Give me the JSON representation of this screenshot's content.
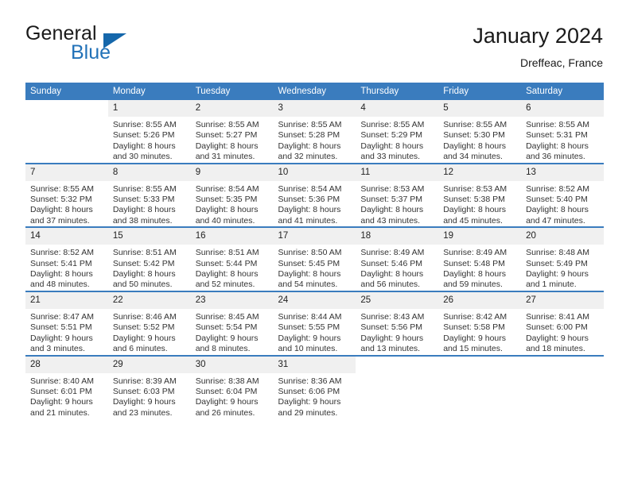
{
  "brand": {
    "word1": "General",
    "word2": "Blue",
    "triangle_color": "#1567ab",
    "blue_text_color": "#2272b8"
  },
  "header": {
    "title": "January 2024",
    "subtitle": "Dreffeac, France"
  },
  "theme": {
    "header_bg": "#3a7cbe",
    "daynum_bg": "#f0f0f0",
    "text": "#222222"
  },
  "calendar": {
    "weekdays": [
      "Sunday",
      "Monday",
      "Tuesday",
      "Wednesday",
      "Thursday",
      "Friday",
      "Saturday"
    ],
    "labels": {
      "sunrise": "Sunrise:",
      "sunset": "Sunset:",
      "daylight": "Daylight:"
    },
    "weeks": [
      [
        {
          "day": "",
          "sunrise": "",
          "sunset": "",
          "daylight_line1": "",
          "daylight_line2": "",
          "blank": true
        },
        {
          "day": "1",
          "sunrise": "Sunrise: 8:55 AM",
          "sunset": "Sunset: 5:26 PM",
          "daylight_line1": "Daylight: 8 hours",
          "daylight_line2": "and 30 minutes."
        },
        {
          "day": "2",
          "sunrise": "Sunrise: 8:55 AM",
          "sunset": "Sunset: 5:27 PM",
          "daylight_line1": "Daylight: 8 hours",
          "daylight_line2": "and 31 minutes."
        },
        {
          "day": "3",
          "sunrise": "Sunrise: 8:55 AM",
          "sunset": "Sunset: 5:28 PM",
          "daylight_line1": "Daylight: 8 hours",
          "daylight_line2": "and 32 minutes."
        },
        {
          "day": "4",
          "sunrise": "Sunrise: 8:55 AM",
          "sunset": "Sunset: 5:29 PM",
          "daylight_line1": "Daylight: 8 hours",
          "daylight_line2": "and 33 minutes."
        },
        {
          "day": "5",
          "sunrise": "Sunrise: 8:55 AM",
          "sunset": "Sunset: 5:30 PM",
          "daylight_line1": "Daylight: 8 hours",
          "daylight_line2": "and 34 minutes."
        },
        {
          "day": "6",
          "sunrise": "Sunrise: 8:55 AM",
          "sunset": "Sunset: 5:31 PM",
          "daylight_line1": "Daylight: 8 hours",
          "daylight_line2": "and 36 minutes."
        }
      ],
      [
        {
          "day": "7",
          "sunrise": "Sunrise: 8:55 AM",
          "sunset": "Sunset: 5:32 PM",
          "daylight_line1": "Daylight: 8 hours",
          "daylight_line2": "and 37 minutes."
        },
        {
          "day": "8",
          "sunrise": "Sunrise: 8:55 AM",
          "sunset": "Sunset: 5:33 PM",
          "daylight_line1": "Daylight: 8 hours",
          "daylight_line2": "and 38 minutes."
        },
        {
          "day": "9",
          "sunrise": "Sunrise: 8:54 AM",
          "sunset": "Sunset: 5:35 PM",
          "daylight_line1": "Daylight: 8 hours",
          "daylight_line2": "and 40 minutes."
        },
        {
          "day": "10",
          "sunrise": "Sunrise: 8:54 AM",
          "sunset": "Sunset: 5:36 PM",
          "daylight_line1": "Daylight: 8 hours",
          "daylight_line2": "and 41 minutes."
        },
        {
          "day": "11",
          "sunrise": "Sunrise: 8:53 AM",
          "sunset": "Sunset: 5:37 PM",
          "daylight_line1": "Daylight: 8 hours",
          "daylight_line2": "and 43 minutes."
        },
        {
          "day": "12",
          "sunrise": "Sunrise: 8:53 AM",
          "sunset": "Sunset: 5:38 PM",
          "daylight_line1": "Daylight: 8 hours",
          "daylight_line2": "and 45 minutes."
        },
        {
          "day": "13",
          "sunrise": "Sunrise: 8:52 AM",
          "sunset": "Sunset: 5:40 PM",
          "daylight_line1": "Daylight: 8 hours",
          "daylight_line2": "and 47 minutes."
        }
      ],
      [
        {
          "day": "14",
          "sunrise": "Sunrise: 8:52 AM",
          "sunset": "Sunset: 5:41 PM",
          "daylight_line1": "Daylight: 8 hours",
          "daylight_line2": "and 48 minutes."
        },
        {
          "day": "15",
          "sunrise": "Sunrise: 8:51 AM",
          "sunset": "Sunset: 5:42 PM",
          "daylight_line1": "Daylight: 8 hours",
          "daylight_line2": "and 50 minutes."
        },
        {
          "day": "16",
          "sunrise": "Sunrise: 8:51 AM",
          "sunset": "Sunset: 5:44 PM",
          "daylight_line1": "Daylight: 8 hours",
          "daylight_line2": "and 52 minutes."
        },
        {
          "day": "17",
          "sunrise": "Sunrise: 8:50 AM",
          "sunset": "Sunset: 5:45 PM",
          "daylight_line1": "Daylight: 8 hours",
          "daylight_line2": "and 54 minutes."
        },
        {
          "day": "18",
          "sunrise": "Sunrise: 8:49 AM",
          "sunset": "Sunset: 5:46 PM",
          "daylight_line1": "Daylight: 8 hours",
          "daylight_line2": "and 56 minutes."
        },
        {
          "day": "19",
          "sunrise": "Sunrise: 8:49 AM",
          "sunset": "Sunset: 5:48 PM",
          "daylight_line1": "Daylight: 8 hours",
          "daylight_line2": "and 59 minutes."
        },
        {
          "day": "20",
          "sunrise": "Sunrise: 8:48 AM",
          "sunset": "Sunset: 5:49 PM",
          "daylight_line1": "Daylight: 9 hours",
          "daylight_line2": "and 1 minute."
        }
      ],
      [
        {
          "day": "21",
          "sunrise": "Sunrise: 8:47 AM",
          "sunset": "Sunset: 5:51 PM",
          "daylight_line1": "Daylight: 9 hours",
          "daylight_line2": "and 3 minutes."
        },
        {
          "day": "22",
          "sunrise": "Sunrise: 8:46 AM",
          "sunset": "Sunset: 5:52 PM",
          "daylight_line1": "Daylight: 9 hours",
          "daylight_line2": "and 6 minutes."
        },
        {
          "day": "23",
          "sunrise": "Sunrise: 8:45 AM",
          "sunset": "Sunset: 5:54 PM",
          "daylight_line1": "Daylight: 9 hours",
          "daylight_line2": "and 8 minutes."
        },
        {
          "day": "24",
          "sunrise": "Sunrise: 8:44 AM",
          "sunset": "Sunset: 5:55 PM",
          "daylight_line1": "Daylight: 9 hours",
          "daylight_line2": "and 10 minutes."
        },
        {
          "day": "25",
          "sunrise": "Sunrise: 8:43 AM",
          "sunset": "Sunset: 5:56 PM",
          "daylight_line1": "Daylight: 9 hours",
          "daylight_line2": "and 13 minutes."
        },
        {
          "day": "26",
          "sunrise": "Sunrise: 8:42 AM",
          "sunset": "Sunset: 5:58 PM",
          "daylight_line1": "Daylight: 9 hours",
          "daylight_line2": "and 15 minutes."
        },
        {
          "day": "27",
          "sunrise": "Sunrise: 8:41 AM",
          "sunset": "Sunset: 6:00 PM",
          "daylight_line1": "Daylight: 9 hours",
          "daylight_line2": "and 18 minutes."
        }
      ],
      [
        {
          "day": "28",
          "sunrise": "Sunrise: 8:40 AM",
          "sunset": "Sunset: 6:01 PM",
          "daylight_line1": "Daylight: 9 hours",
          "daylight_line2": "and 21 minutes."
        },
        {
          "day": "29",
          "sunrise": "Sunrise: 8:39 AM",
          "sunset": "Sunset: 6:03 PM",
          "daylight_line1": "Daylight: 9 hours",
          "daylight_line2": "and 23 minutes."
        },
        {
          "day": "30",
          "sunrise": "Sunrise: 8:38 AM",
          "sunset": "Sunset: 6:04 PM",
          "daylight_line1": "Daylight: 9 hours",
          "daylight_line2": "and 26 minutes."
        },
        {
          "day": "31",
          "sunrise": "Sunrise: 8:36 AM",
          "sunset": "Sunset: 6:06 PM",
          "daylight_line1": "Daylight: 9 hours",
          "daylight_line2": "and 29 minutes."
        },
        {
          "day": "",
          "sunrise": "",
          "sunset": "",
          "daylight_line1": "",
          "daylight_line2": "",
          "blank": true
        },
        {
          "day": "",
          "sunrise": "",
          "sunset": "",
          "daylight_line1": "",
          "daylight_line2": "",
          "blank": true
        },
        {
          "day": "",
          "sunrise": "",
          "sunset": "",
          "daylight_line1": "",
          "daylight_line2": "",
          "blank": true
        }
      ]
    ]
  }
}
